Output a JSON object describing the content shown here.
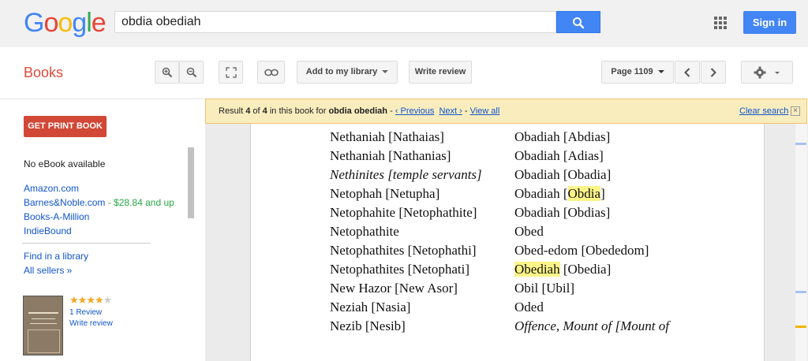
{
  "header": {
    "logo_letters": [
      {
        "ch": "G",
        "color": "#4285f4"
      },
      {
        "ch": "o",
        "color": "#ea4335"
      },
      {
        "ch": "o",
        "color": "#fbbc05"
      },
      {
        "ch": "g",
        "color": "#4285f4"
      },
      {
        "ch": "l",
        "color": "#34a853"
      },
      {
        "ch": "e",
        "color": "#ea4335"
      }
    ],
    "search_value": "obdia obediah",
    "search_icon": "search-icon",
    "apps_icon": "apps-grid-icon",
    "signin_label": "Sign in"
  },
  "toolbar": {
    "section_title": "Books",
    "zoom_in_icon": "zoom-in-icon",
    "zoom_out_icon": "zoom-out-icon",
    "fullscreen_icon": "fullscreen-icon",
    "link_icon": "link-icon",
    "add_library_label": "Add to my library",
    "write_review_label": "Write review",
    "page_label": "Page 1109",
    "prev_icon": "chevron-left-icon",
    "next_icon": "chevron-right-icon",
    "settings_icon": "gear-icon"
  },
  "sidebar": {
    "print_button": "GET PRINT BOOK",
    "no_ebook": "No eBook available",
    "sellers": [
      {
        "name": "Amazon.com",
        "price": ""
      },
      {
        "name": "Barnes&Noble.com",
        "price": " - $28.84 and up"
      },
      {
        "name": "Books-A-Million",
        "price": ""
      },
      {
        "name": "IndieBound",
        "price": ""
      }
    ],
    "find_library": "Find in a library",
    "all_sellers": "All sellers »",
    "rating_stars": 4,
    "rating_max": 5,
    "review_count": "1 Review",
    "write_review": "Write review"
  },
  "banner": {
    "prefix": "Result ",
    "result_num": "4",
    "of": " of ",
    "result_total": "4",
    "middle": " in this book for ",
    "query": "obdia obediah",
    "sep": "  - ",
    "previous": "‹ Previous",
    "next": "Next ›",
    "view_all": "View all",
    "clear": "Clear search",
    "close_glyph": "×"
  },
  "page": {
    "rows": [
      {
        "left": "Nethaniah [Nathaias]",
        "right": "Obadiah [Abdias]"
      },
      {
        "left": "Nethaniah [Nathanias]",
        "right": "Obadiah [Adias]"
      },
      {
        "left": "Nethinites [temple servants]",
        "right": "Obadiah [Obadia]"
      },
      {
        "left": "Netophah [Netupha]",
        "right": "Obadiah [Obdia]"
      },
      {
        "left": "Netophahite [Netophathite]",
        "right": "Obadiah [Obdias]"
      },
      {
        "left": "Netophathite",
        "right": "Obed"
      },
      {
        "left": "Netophathites [Netophathi]",
        "right": "Obed-edom [Obededom]"
      },
      {
        "left": "Netophathites [Netophati]",
        "right": "Obediah [Obedia]"
      },
      {
        "left": "New Hazor [New Asor]",
        "right": "Obil [Ubil]"
      },
      {
        "left": "Neziah [Nasia]",
        "right": "Oded"
      },
      {
        "left": "Nezib [Nesib]",
        "right": "Offence, Mount of [Mount of"
      }
    ],
    "highlight_color": "#fdf488"
  }
}
